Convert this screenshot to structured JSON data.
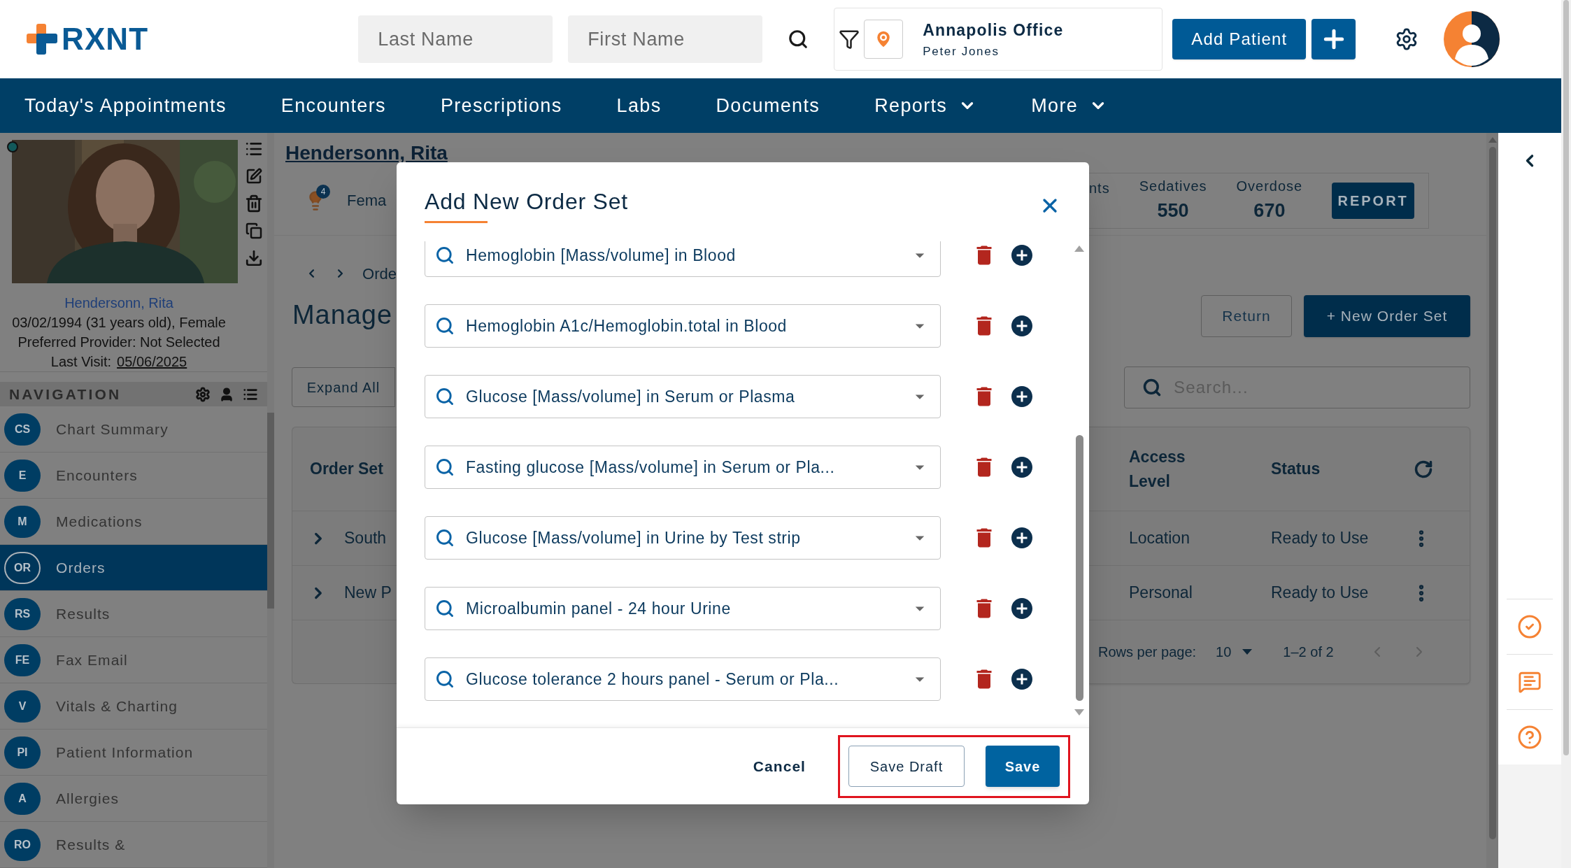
{
  "logo": {
    "text": "RXNT"
  },
  "header": {
    "search_fields": [
      {
        "placeholder": "Last Name"
      },
      {
        "placeholder": "First Name"
      }
    ],
    "location": {
      "office": "Annapolis Office",
      "user": "Peter Jones"
    },
    "add_patient_button": "Add Patient"
  },
  "nav_menu": [
    {
      "label": "Today's Appointments",
      "dropdown": false
    },
    {
      "label": "Encounters",
      "dropdown": false
    },
    {
      "label": "Prescriptions",
      "dropdown": false
    },
    {
      "label": "Labs",
      "dropdown": false
    },
    {
      "label": "Documents",
      "dropdown": false
    },
    {
      "label": "Reports",
      "dropdown": true
    },
    {
      "label": "More",
      "dropdown": true
    }
  ],
  "patient": {
    "name": "Hendersonn, Rita",
    "details": "03/02/1994 (31 years old), Female",
    "provider": "Preferred Provider: Not Selected",
    "last_visit_label": "Last Visit:",
    "last_visit": "05/06/2025"
  },
  "sidebar_navigation": {
    "title": "NAVIGATION",
    "items": [
      {
        "abbr": "CS",
        "label": "Chart Summary",
        "selected": false
      },
      {
        "abbr": "E",
        "label": "Encounters",
        "selected": false
      },
      {
        "abbr": "M",
        "label": "Medications",
        "selected": false
      },
      {
        "abbr": "OR",
        "label": "Orders",
        "selected": true
      },
      {
        "abbr": "RS",
        "label": "Results",
        "selected": false
      },
      {
        "abbr": "FE",
        "label": "Fax Email",
        "selected": false
      },
      {
        "abbr": "V",
        "label": "Vitals & Charting",
        "selected": false
      },
      {
        "abbr": "PI",
        "label": "Patient Information",
        "selected": false
      },
      {
        "abbr": "A",
        "label": "Allergies",
        "selected": false
      },
      {
        "abbr": "RO",
        "label": "Results &",
        "selected": false
      }
    ]
  },
  "page": {
    "patient_title": "Hendersonn, Rita",
    "alert_count": "4",
    "gender": "Fema",
    "stats": [
      {
        "label": "nts"
      },
      {
        "label": "Sedatives",
        "value": "550"
      },
      {
        "label": "Overdose",
        "value": "670"
      }
    ],
    "report_button": "REPORT",
    "breadcrumb": "Orde",
    "heading": "Manage",
    "return_button": "Return",
    "new_order_set_button": "+ New Order Set",
    "expand_all_button": "Expand All",
    "search": {
      "placeholder": "Search..."
    },
    "table": {
      "columns": [
        "Order Set",
        "Access Level",
        "Status"
      ],
      "rows": [
        {
          "name": "South",
          "access_level": "Location",
          "status": "Ready to Use"
        },
        {
          "name": "New P",
          "access_level": "Personal",
          "status": "Ready to Use"
        }
      ],
      "footer": {
        "rows_per_page_label": "Rows per page:",
        "rows_per_page": "10",
        "range": "1–2 of 2"
      }
    }
  },
  "modal": {
    "title": "Add New Order Set",
    "items": [
      "Hemoglobin [Mass/volume] in Blood",
      "Hemoglobin A1c/Hemoglobin.total in Blood",
      "Glucose [Mass/volume] in Serum or Plasma",
      "Fasting glucose [Mass/volume] in Serum or Pla...",
      "Glucose [Mass/volume] in Urine by Test strip",
      "Microalbumin panel - 24 hour Urine",
      "Glucose tolerance 2 hours panel - Serum or Pla..."
    ],
    "cancel_button": "Cancel",
    "save_draft_button": "Save Draft",
    "save_button": "Save",
    "highlighted": true
  }
}
